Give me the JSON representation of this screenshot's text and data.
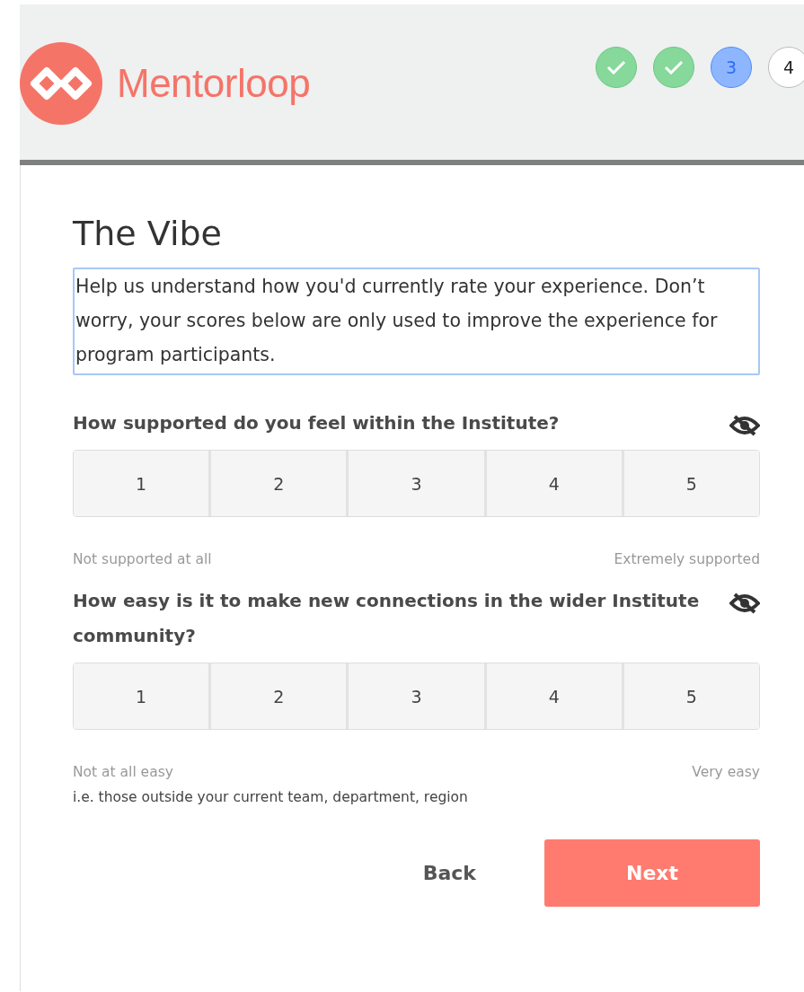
{
  "logo": {
    "name": "Mentorloop"
  },
  "steps": [
    {
      "kind": "done"
    },
    {
      "kind": "done"
    },
    {
      "kind": "current",
      "label": "3"
    },
    {
      "kind": "todo",
      "label": "4"
    }
  ],
  "title": "The Vibe",
  "intro": "Help us understand how you'd currently rate your experience. Don’t worry, your scores below are only used to improve the experience for program participants.",
  "questions": [
    {
      "text": "How supported do you feel within the Institute?",
      "options": [
        "1",
        "2",
        "3",
        "4",
        "5"
      ],
      "low_label": "Not supported at all",
      "high_label": "Extremely supported"
    },
    {
      "text": "How easy is it to make new connections in the wider Institute community?",
      "options": [
        "1",
        "2",
        "3",
        "4",
        "5"
      ],
      "low_label": "Not at all easy",
      "high_label": "Very easy",
      "hint": "i.e. those outside your current team, department, region"
    }
  ],
  "buttons": {
    "back": "Back",
    "next": "Next"
  }
}
